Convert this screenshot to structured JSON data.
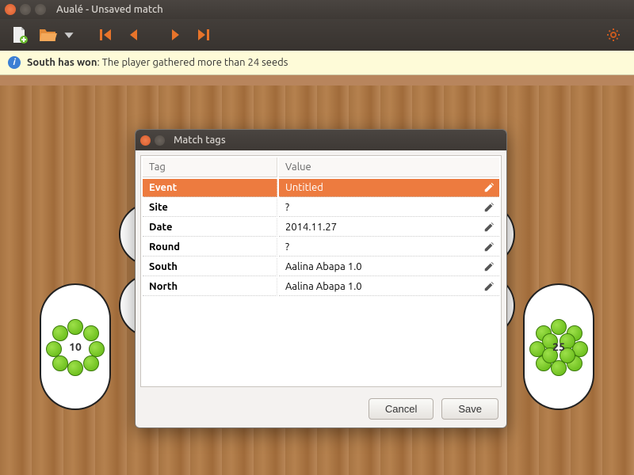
{
  "window": {
    "title": "Aualé - Unsaved match"
  },
  "toolbar": {
    "new_icon": "new-file",
    "open_icon": "open-folder",
    "first_icon": "first",
    "prev_icon": "prev",
    "next_icon": "next",
    "last_icon": "last",
    "settings_icon": "gear"
  },
  "infobar": {
    "bold": "South has won",
    "rest": ": The player gathered more than 24 seeds"
  },
  "stores": {
    "left_count": "10",
    "right_count": "25"
  },
  "dialog": {
    "title": "Match tags",
    "headers": {
      "tag": "Tag",
      "value": "Value"
    },
    "rows": [
      {
        "tag": "Event",
        "value": "Untitled",
        "selected": true
      },
      {
        "tag": "Site",
        "value": "?",
        "selected": false
      },
      {
        "tag": "Date",
        "value": "2014.11.27",
        "selected": false
      },
      {
        "tag": "Round",
        "value": "?",
        "selected": false
      },
      {
        "tag": "South",
        "value": "Aalina Abapa 1.0",
        "selected": false
      },
      {
        "tag": "North",
        "value": "Aalina Abapa 1.0",
        "selected": false
      }
    ],
    "buttons": {
      "cancel": "Cancel",
      "save": "Save"
    }
  }
}
